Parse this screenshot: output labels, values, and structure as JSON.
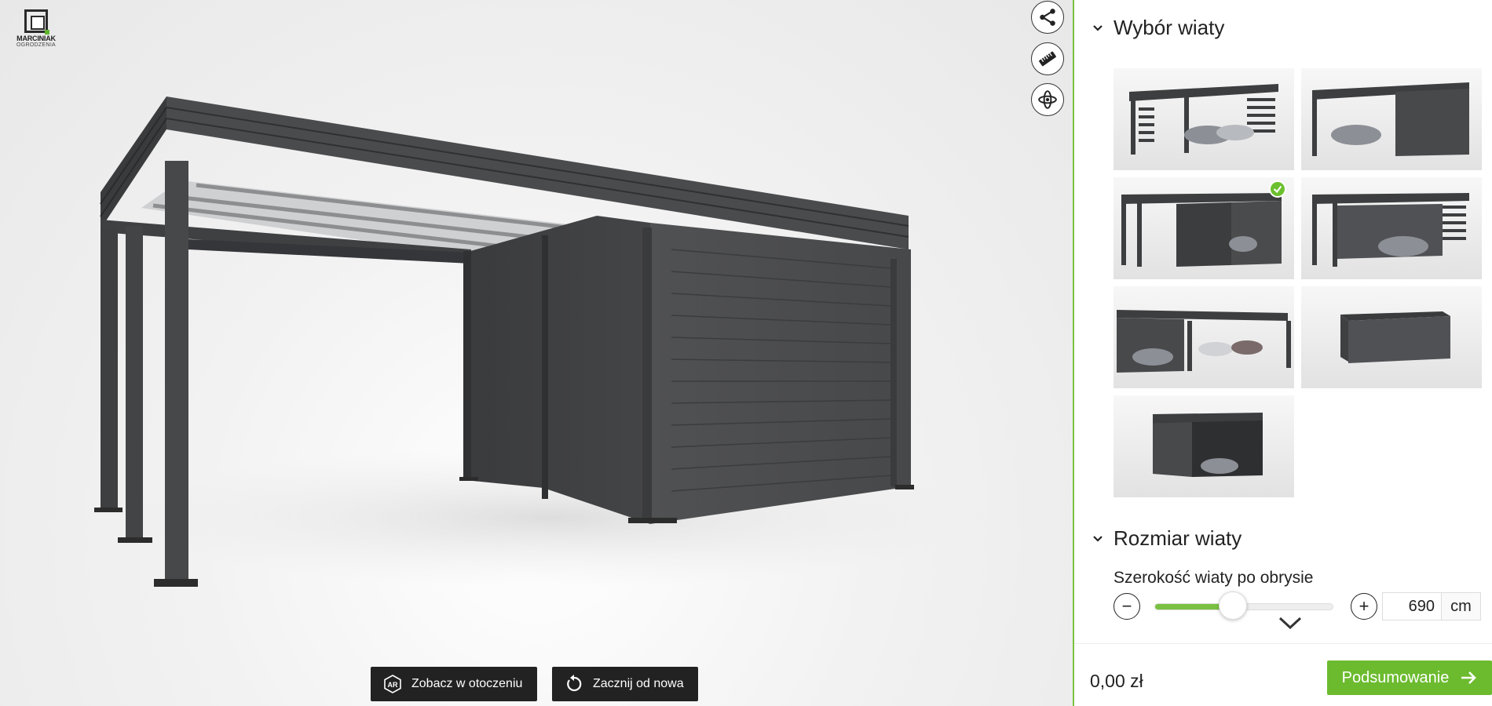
{
  "brand": {
    "name": "MARCINIAK",
    "sub": "OGRODZENIA"
  },
  "viewer": {
    "tools": [
      {
        "icon": "share-icon"
      },
      {
        "icon": "ruler-icon"
      },
      {
        "icon": "rotate-3d-icon"
      }
    ],
    "buttons": {
      "ar_label": "Zobacz w otoczeniu",
      "reset_label": "Zacznij od nowa"
    }
  },
  "sidebar": {
    "section1": {
      "title": "Wybór wiaty"
    },
    "thumbs": [
      {
        "variant": "double-carport-slats",
        "selected": false
      },
      {
        "variant": "carport-with-garage",
        "selected": false
      },
      {
        "variant": "carport-with-side-shed",
        "selected": true
      },
      {
        "variant": "double-carport-slats-back",
        "selected": false
      },
      {
        "variant": "triple-carport",
        "selected": false
      },
      {
        "variant": "closed-garage",
        "selected": false
      },
      {
        "variant": "single-garage-open",
        "selected": false
      }
    ],
    "section2": {
      "title": "Rozmiar wiaty",
      "width_label": "Szerokość wiaty po obrysie",
      "width_value": "690",
      "unit": "cm",
      "slider_fraction": 0.44
    }
  },
  "footer": {
    "price": "0,00 zł",
    "summary_label": "Podsumowanie"
  },
  "colors": {
    "accent": "#6cbb2f",
    "dark": "#222222",
    "steel": "#3d3e40"
  }
}
